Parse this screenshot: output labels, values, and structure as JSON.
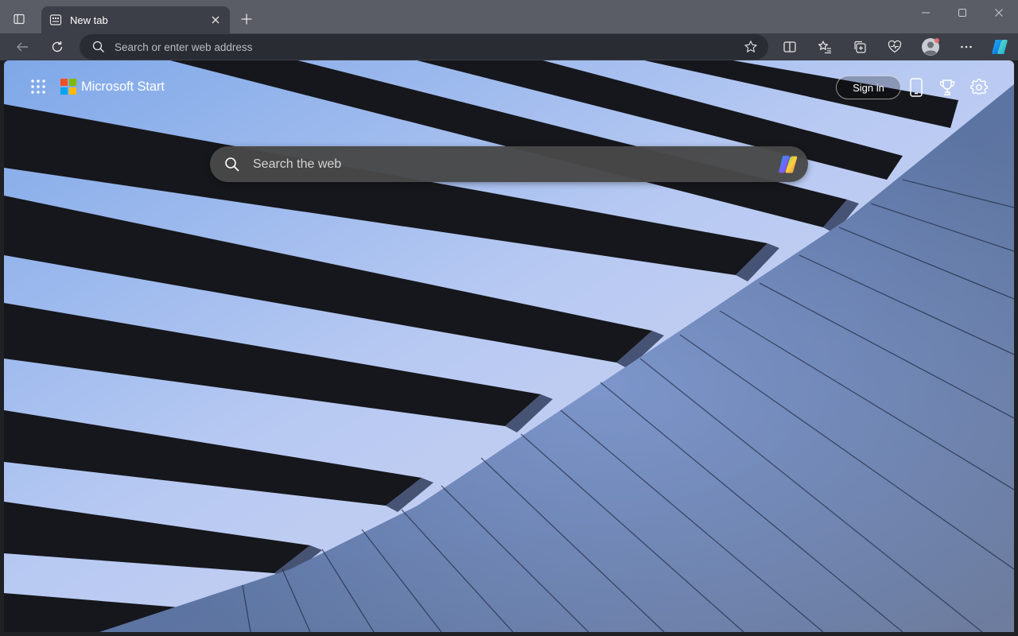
{
  "browser": {
    "tab": {
      "title": "New tab"
    },
    "address_bar": {
      "placeholder": "Search or enter web address"
    }
  },
  "page": {
    "brand": {
      "name": "Microsoft Start"
    },
    "header": {
      "sign_in_label": "Sign in"
    },
    "search": {
      "placeholder": "Search the web"
    }
  },
  "colors": {
    "ms_red": "#f25022",
    "ms_green": "#7fba00",
    "ms_blue": "#00a4ef",
    "ms_yellow": "#ffb900"
  }
}
